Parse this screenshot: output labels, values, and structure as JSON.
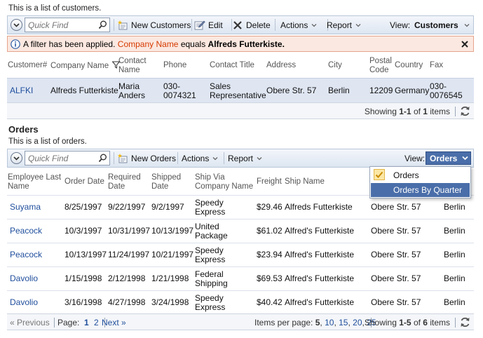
{
  "customers": {
    "description": "This is a list of customers.",
    "toolbar": {
      "quick_find_placeholder": "Quick Find",
      "new_label": "New Customers",
      "edit_label": "Edit",
      "delete_label": "Delete",
      "actions_label": "Actions",
      "report_label": "Report",
      "view_label": "View:",
      "view_value": "Customers"
    },
    "filter": {
      "prefix": "A filter has been applied.",
      "field": "Company Name",
      "operator": "equals",
      "value": "Alfreds Futterkiste."
    },
    "columns": {
      "customer": "Customer#",
      "company": "Company Name",
      "contact_name_1": "Contact",
      "contact_name_2": "Name",
      "phone": "Phone",
      "contact_title": "Contact Title",
      "address": "Address",
      "city": "City",
      "postal_1": "Postal",
      "postal_2": "Code",
      "country": "Country",
      "fax": "Fax"
    },
    "row": {
      "customer": "ALFKI",
      "company": "Alfreds Futterkiste",
      "contact_name_1": "Maria",
      "contact_name_2": "Anders",
      "phone_1": "030-",
      "phone_2": "0074321",
      "title_1": "Sales",
      "title_2": "Representative",
      "address": "Obere Str. 57",
      "city": "Berlin",
      "postal": "12209",
      "country": "Germany",
      "fax_1": "030-",
      "fax_2": "0076545"
    },
    "pager": {
      "showing": "Showing",
      "range": "1-1",
      "of": "of",
      "total": "1",
      "items": "items"
    }
  },
  "orders": {
    "title": "Orders",
    "description": "This is a list of orders.",
    "toolbar": {
      "quick_find_placeholder": "Quick Find",
      "new_label": "New Orders",
      "actions_label": "Actions",
      "report_label": "Report",
      "view_label": "View:",
      "view_value": "Orders"
    },
    "view_menu": {
      "items": [
        "Orders",
        "Orders By Quarter"
      ]
    },
    "columns": {
      "employee_1": "Employee Last",
      "employee_2": "Name",
      "order_date": "Order Date",
      "required_1": "Required",
      "required_2": "Date",
      "shipped_1": "Shipped",
      "shipped_2": "Date",
      "shipvia_1": "Ship Via",
      "shipvia_2": "Company Name",
      "freight": "Freight",
      "ship_name": "Ship Name"
    },
    "rows": [
      {
        "employee": "Suyama",
        "order_date": "8/25/1997",
        "required": "9/22/1997",
        "shipped": "9/2/1997",
        "via_1": "Speedy",
        "via_2": "Express",
        "freight": "$29.46",
        "ship_name": "Alfreds Futterkiste",
        "address": "Obere Str. 57",
        "city": "Berlin"
      },
      {
        "employee": "Peacock",
        "order_date": "10/3/1997",
        "required": "10/31/1997",
        "shipped": "10/13/1997",
        "via_1": "United",
        "via_2": "Package",
        "freight": "$61.02",
        "ship_name": "Alfred's Futterkiste",
        "address": "Obere Str. 57",
        "city": "Berlin"
      },
      {
        "employee": "Peacock",
        "order_date": "10/13/1997",
        "required": "11/24/1997",
        "shipped": "10/21/1997",
        "via_1": "Speedy",
        "via_2": "Express",
        "freight": "$23.94",
        "ship_name": "Alfred's Futterkiste",
        "address": "Obere Str. 57",
        "city": "Berlin"
      },
      {
        "employee": "Davolio",
        "order_date": "1/15/1998",
        "required": "2/12/1998",
        "shipped": "1/21/1998",
        "via_1": "Federal",
        "via_2": "Shipping",
        "freight": "$69.53",
        "ship_name": "Alfred's Futterkiste",
        "address": "Obere Str. 57",
        "city": "Berlin"
      },
      {
        "employee": "Davolio",
        "order_date": "3/16/1998",
        "required": "4/27/1998",
        "shipped": "3/24/1998",
        "via_1": "Speedy",
        "via_2": "Express",
        "freight": "$40.42",
        "ship_name": "Alfred's Futterkiste",
        "address": "Obere Str. 57",
        "city": "Berlin"
      }
    ],
    "pager": {
      "previous": "« Previous",
      "page_label": "Page:",
      "pages": [
        "1",
        "2"
      ],
      "next": "Next »",
      "items_per_page": "Items per page:",
      "page_sizes": [
        "5",
        "10",
        "15",
        "20",
        "25"
      ],
      "showing": "Showing",
      "range": "1-5",
      "of": "of",
      "total": "6",
      "items": "items"
    }
  },
  "colors": {
    "accent": "#1f4e9c",
    "filter_field": "#d63a00",
    "selected_row": "#dfe6f2",
    "menu_highlight": "#4a6ea9"
  }
}
